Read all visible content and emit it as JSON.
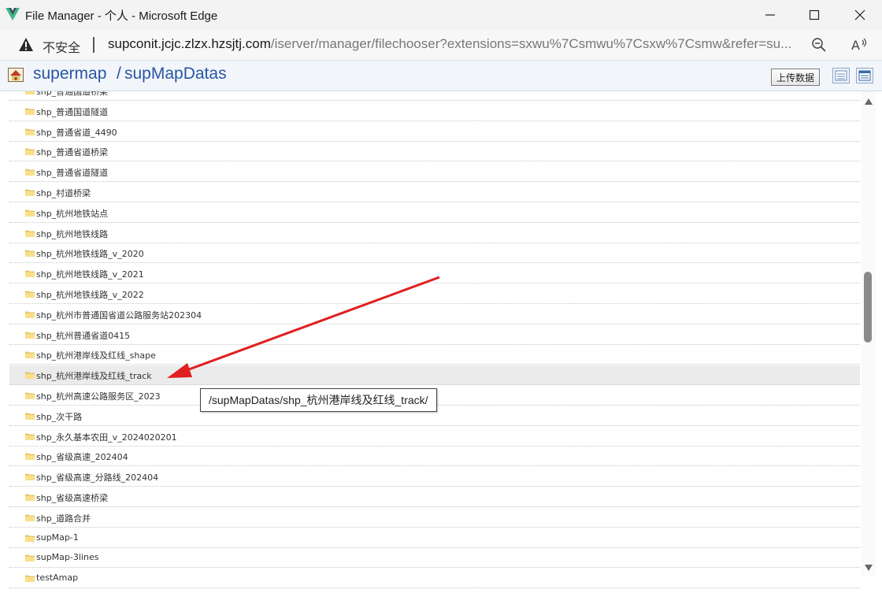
{
  "window": {
    "title": "File Manager - 个人 - Microsoft Edge"
  },
  "address_bar": {
    "security_label": "不安全",
    "url_host": "supconit.jcjc.zlzx.hzsjtj.com",
    "url_path": "/iserver/manager/filechooser?extensions=sxwu%7Csmwu%7Csxw%7Csmw&refer=su..."
  },
  "header": {
    "breadcrumb_root": "supermap",
    "breadcrumb_separator": "/",
    "breadcrumb_current": "supMapDatas",
    "upload_label": "上传数据"
  },
  "files": [
    {
      "name": "shp_普通国道桥梁"
    },
    {
      "name": "shp_普通国道隧道"
    },
    {
      "name": "shp_普通省道_4490"
    },
    {
      "name": "shp_普通省道桥梁"
    },
    {
      "name": "shp_普通省道隧道"
    },
    {
      "name": "shp_村道桥梁"
    },
    {
      "name": "shp_杭州地铁站点"
    },
    {
      "name": "shp_杭州地铁线路"
    },
    {
      "name": "shp_杭州地铁线路_v_2020"
    },
    {
      "name": "shp_杭州地铁线路_v_2021"
    },
    {
      "name": "shp_杭州地铁线路_v_2022"
    },
    {
      "name": "shp_杭州市普通国省道公路服务站202304"
    },
    {
      "name": "shp_杭州普通省道0415"
    },
    {
      "name": "shp_杭州港岸线及红线_shape"
    },
    {
      "name": "shp_杭州港岸线及红线_track"
    },
    {
      "name": "shp_杭州高速公路服务区_2023"
    },
    {
      "name": "shp_次干路"
    },
    {
      "name": "shp_永久基本农田_v_2024020201"
    },
    {
      "name": "shp_省级高速_202404"
    },
    {
      "name": "shp_省级高速_分路线_202404"
    },
    {
      "name": "shp_省级高速桥梁"
    },
    {
      "name": "shp_道路合并"
    },
    {
      "name": "supMap-1"
    },
    {
      "name": "supMap-3lines"
    },
    {
      "name": "testAmap"
    }
  ],
  "tooltip": {
    "text": "/supMapDatas/shp_杭州港岸线及红线_track/"
  },
  "colors": {
    "breadcrumb": "#2956a3",
    "arrow": "#e02020",
    "highlight_row": "#ebebeb"
  }
}
